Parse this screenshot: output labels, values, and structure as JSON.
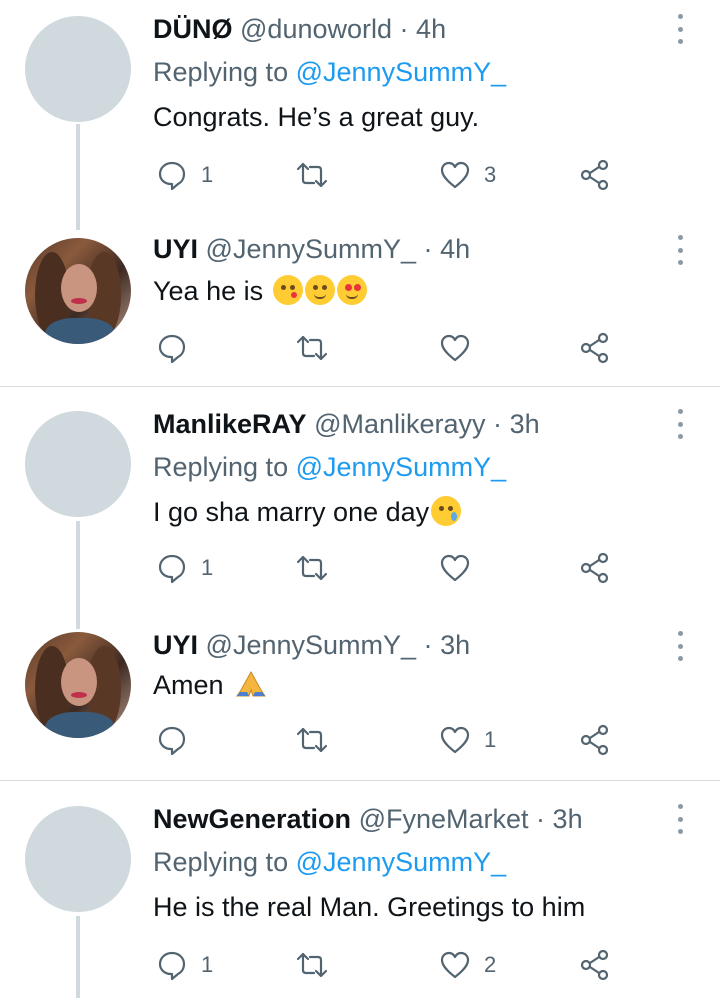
{
  "tweets": [
    {
      "name": "DÜNØ",
      "handle": "@dunoworld",
      "time": "4h",
      "replying_prefix": "Replying to",
      "replying_to": "@JennySummY_",
      "text": "Congrats. He’s a great guy.",
      "reply_count": "1",
      "retweet_count": "",
      "like_count": "3"
    },
    {
      "name": "UYI",
      "handle": "@JennySummY_",
      "time": "4h",
      "text": "Yea he is",
      "emojis": [
        "kissing-face-emoji",
        "smiling-face-emoji",
        "heart-eyes-emoji"
      ],
      "reply_count": "",
      "retweet_count": "",
      "like_count": ""
    },
    {
      "name": "ManlikeRAY",
      "handle": "@Manlikerayy",
      "time": "3h",
      "replying_prefix": "Replying to",
      "replying_to": "@JennySummY_",
      "text": "I go sha marry one day",
      "emojis": [
        "sad-relieved-face-emoji"
      ],
      "reply_count": "1",
      "retweet_count": "",
      "like_count": ""
    },
    {
      "name": "UYI",
      "handle": "@JennySummY_",
      "time": "3h",
      "text": "Amen",
      "emojis": [
        "folded-hands-emoji"
      ],
      "reply_count": "",
      "retweet_count": "",
      "like_count": "1"
    },
    {
      "name": "NewGeneration",
      "handle": "@FyneMarket",
      "time": "3h",
      "replying_prefix": "Replying to",
      "replying_to": "@JennySummY_",
      "text": "He is the real Man. Greetings to him",
      "reply_count": "1",
      "retweet_count": "",
      "like_count": "2"
    }
  ],
  "dot_separator": "·",
  "colors": {
    "text": "#0f1419",
    "secondary": "#536471",
    "link": "#1d9bf0",
    "avatar_placeholder": "#cfd9de"
  }
}
